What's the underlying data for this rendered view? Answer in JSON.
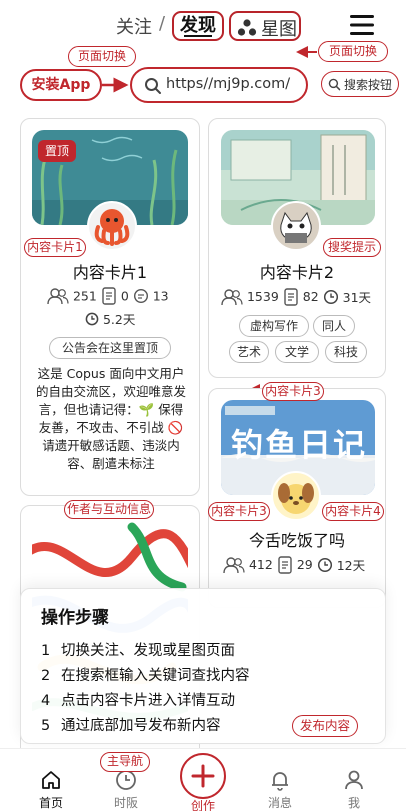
{
  "header": {
    "tab_follow": "关注",
    "separator": "/",
    "tab_discover": "发现",
    "tab_star": "星图",
    "menu_icon": "hamburger-menu-icon"
  },
  "annotations": {
    "page_switch_left": "页面切换",
    "page_switch_right": "页面切换",
    "content_card_1": "内容卡片1",
    "search_tip": "搜奖提示",
    "content_card_3_top": "内容卡片3",
    "author_interaction": "作者与互动信息",
    "content_card_3_bottom": "内容卡片3",
    "content_card_4": "内容卡片4",
    "main_nav": "主导航",
    "publish_content": "发布内容"
  },
  "toolbar": {
    "install_app": "安装App",
    "search_value": "https//mj9p.com/",
    "search_button_hint": "搜索按钮"
  },
  "cards": [
    {
      "pinned_badge": "置顶",
      "title": "内容卡片1",
      "stats": {
        "followers": "251",
        "docs": "0",
        "comments": "13",
        "time": "5.2天"
      },
      "notice": "公告会在这里置顶",
      "body": "这是 Copus 面向中文用户的自由交流区，欢迎唯意发言，但也请记得：🌱 保得友善，不攻击、不引战 🚫 请遗开敏感话题、违淡内容、剧遣未标注"
    },
    {
      "title": "内容卡片2",
      "stats": {
        "followers": "1539",
        "docs": "82",
        "time": "31天"
      },
      "tags": [
        "虚构写作",
        "同人",
        "艺术",
        "文学",
        "科技"
      ]
    },
    {
      "image_text": "钓鱼日记",
      "title": "今舌吃饭了吗",
      "stats": {
        "followers": "412",
        "docs": "29",
        "time": "12天"
      }
    },
    {
      "title": ""
    }
  ],
  "steps": {
    "title": "操作步骤",
    "items": [
      {
        "num": "1",
        "text": "切换关注、发现或星图页面"
      },
      {
        "num": "2",
        "text": "在搜索框输入关键词查找内容"
      },
      {
        "num": "4",
        "text": "点击内容卡片进入详情互动"
      },
      {
        "num": "5",
        "text": "通过底部加号发布新内容"
      }
    ]
  },
  "bottom_nav": [
    {
      "label": "首页",
      "icon": "home-icon",
      "active": true
    },
    {
      "label": "时阪",
      "icon": "clock-icon",
      "active": false
    },
    {
      "label": "创作",
      "icon": "plus-icon",
      "active": false
    },
    {
      "label": "消息",
      "icon": "bell-icon",
      "active": false
    },
    {
      "label": "我",
      "icon": "person-icon",
      "active": false
    }
  ],
  "colors": {
    "accent": "#c0272d",
    "nav_active": "#111111",
    "nav_inactive": "#777777"
  }
}
